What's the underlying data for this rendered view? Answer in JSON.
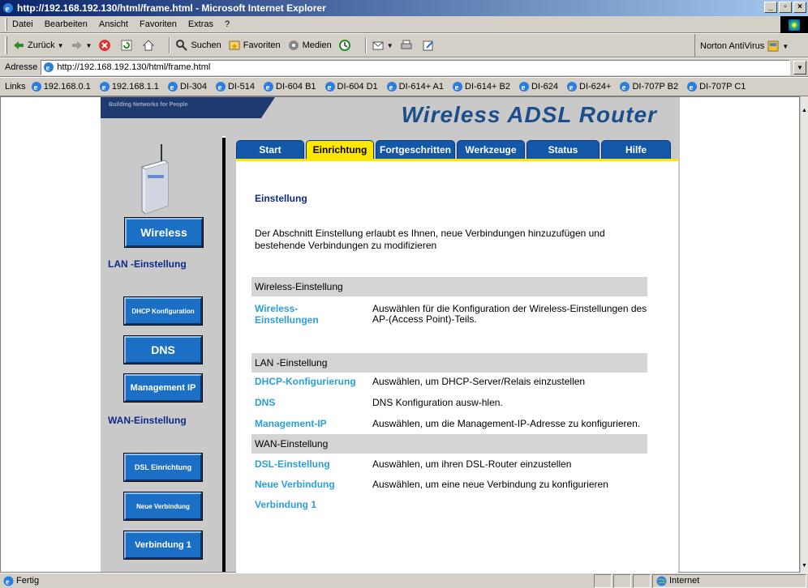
{
  "window": {
    "title": "http://192.168.192.130/html/frame.html - Microsoft Internet Explorer",
    "buttons": [
      "_",
      "8",
      "x"
    ]
  },
  "menu": [
    "Datei",
    "Bearbeiten",
    "Ansicht",
    "Favoriten",
    "Extras",
    "?"
  ],
  "toolbar": {
    "back": "Zurück",
    "search": "Suchen",
    "favorites": "Favoriten",
    "media": "Medien",
    "norton": "Norton AntiVirus"
  },
  "address": {
    "label": "Adresse",
    "url": "http://192.168.192.130/html/frame.html"
  },
  "links": {
    "label": "Links",
    "items": [
      "192.168.0.1",
      "192.168.1.1",
      "DI-304",
      "DI-514",
      "DI-604 B1",
      "DI-604 D1",
      "DI-614+ A1",
      "DI-614+ B2",
      "DI-624",
      "DI-624+",
      "DI-707P B2",
      "DI-707P C1"
    ]
  },
  "router": {
    "banner_tagline": "Building Networks for People",
    "banner_title": "Wireless ADSL Router",
    "tabs": [
      {
        "label": "Start"
      },
      {
        "label": "Einrichtung"
      },
      {
        "label": "Fortgeschritten"
      },
      {
        "label": "Werkzeuge"
      },
      {
        "label": "Status"
      },
      {
        "label": "Hilfe"
      }
    ],
    "nav": {
      "wireless": "Wireless",
      "lan_heading": "LAN -Einstellung",
      "dhcp": "DHCP Konfiguration",
      "dns": "DNS",
      "mgmt": "Management IP",
      "wan_heading": "WAN-Einstellung",
      "dsl": "DSL Einrichtung",
      "new_conn": "Neue Verbindung",
      "conn1": "Verbindung 1"
    },
    "main": {
      "title": "Einstellung",
      "intro": "Der Abschnitt Einstellung erlaubt es Ihnen, neue Verbindungen hinzuzufügen und bestehende Verbindungen zu modifizieren",
      "sec_wireless": "Wireless-Einstellung",
      "wireless_link": "Wireless-Einstellungen",
      "wireless_desc": "Auswählen für die Konfiguration der Wireless-Einstellungen des AP-(Access Point)-Teils.",
      "sec_lan": "LAN -Einstellung",
      "dhcp_link": "DHCP-Konfigurierung",
      "dhcp_desc": "Auswählen, um DHCP-Server/Relais einzustellen",
      "dns_link": "DNS",
      "dns_desc": "DNS Konfiguration ausw-hlen.",
      "mgmt_link": "Management-IP",
      "mgmt_desc": "Auswählen, um die Management-IP-Adresse zu konfigurieren.",
      "sec_wan": "WAN-Einstellung",
      "dsl_link": "DSL-Einstellung",
      "dsl_desc": "Auswählen, um ihren DSL-Router einzustellen",
      "new_link": "Neue Verbindung",
      "new_desc": "Auswählen, um eine neue Verbindung zu konfigurieren",
      "conn1_link": "Verbindung 1"
    }
  },
  "status": {
    "text": "Fertig",
    "zone": "Internet"
  }
}
